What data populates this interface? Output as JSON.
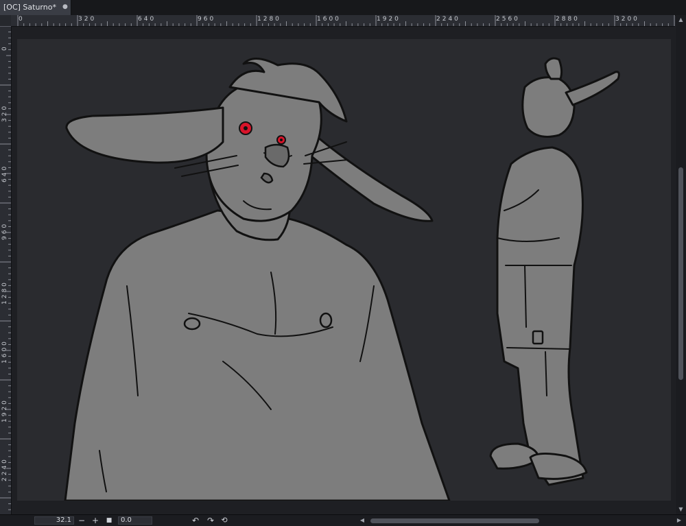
{
  "document_tab": {
    "title": "[OC] Saturno*",
    "close_icon": "dot-close-icon"
  },
  "ruler": {
    "horizontal": [
      "0",
      "320",
      "640",
      "960",
      "1280",
      "1600",
      "1920",
      "2240",
      "2560",
      "2880",
      "3200"
    ],
    "vertical": [
      "0",
      "320",
      "640",
      "960",
      "1280",
      "1600",
      "1920",
      "2240"
    ]
  },
  "status": {
    "zoom": "32.1",
    "zoom_out": "−",
    "zoom_in": "+",
    "angle": "0.0",
    "icons": [
      "fit-square-icon",
      "rotate-left-icon",
      "rotate-right-icon",
      "reset-rotation-icon"
    ]
  },
  "colors": {
    "canvas": "#2a2b2f",
    "figure_fill": "#7d7d7d",
    "line": "#111111",
    "eye": "#d8142a",
    "ui_bg": "#1f2024"
  }
}
